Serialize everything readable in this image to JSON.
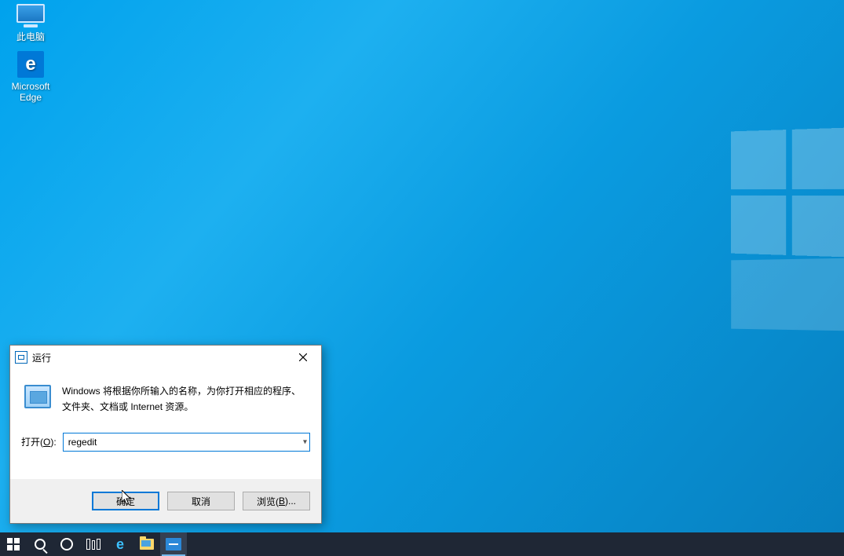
{
  "desktop": {
    "icons": {
      "this_pc": "此电脑",
      "edge_line1": "Microsoft",
      "edge_line2": "Edge"
    }
  },
  "run_dialog": {
    "title": "运行",
    "description": "Windows 将根据你所输入的名称，为你打开相应的程序、文件夹、文档或 Internet 资源。",
    "open_label_prefix": "打开(",
    "open_label_hotkey": "O",
    "open_label_suffix": "):",
    "input_value": "regedit",
    "buttons": {
      "ok": "确定",
      "cancel": "取消",
      "browse_prefix": "浏览(",
      "browse_hotkey": "B",
      "browse_suffix": ")..."
    }
  },
  "taskbar": {
    "start": "start",
    "search": "search",
    "cortana": "cortana",
    "taskview": "task-view",
    "edge": "e",
    "explorer": "file-explorer",
    "run": "run"
  }
}
